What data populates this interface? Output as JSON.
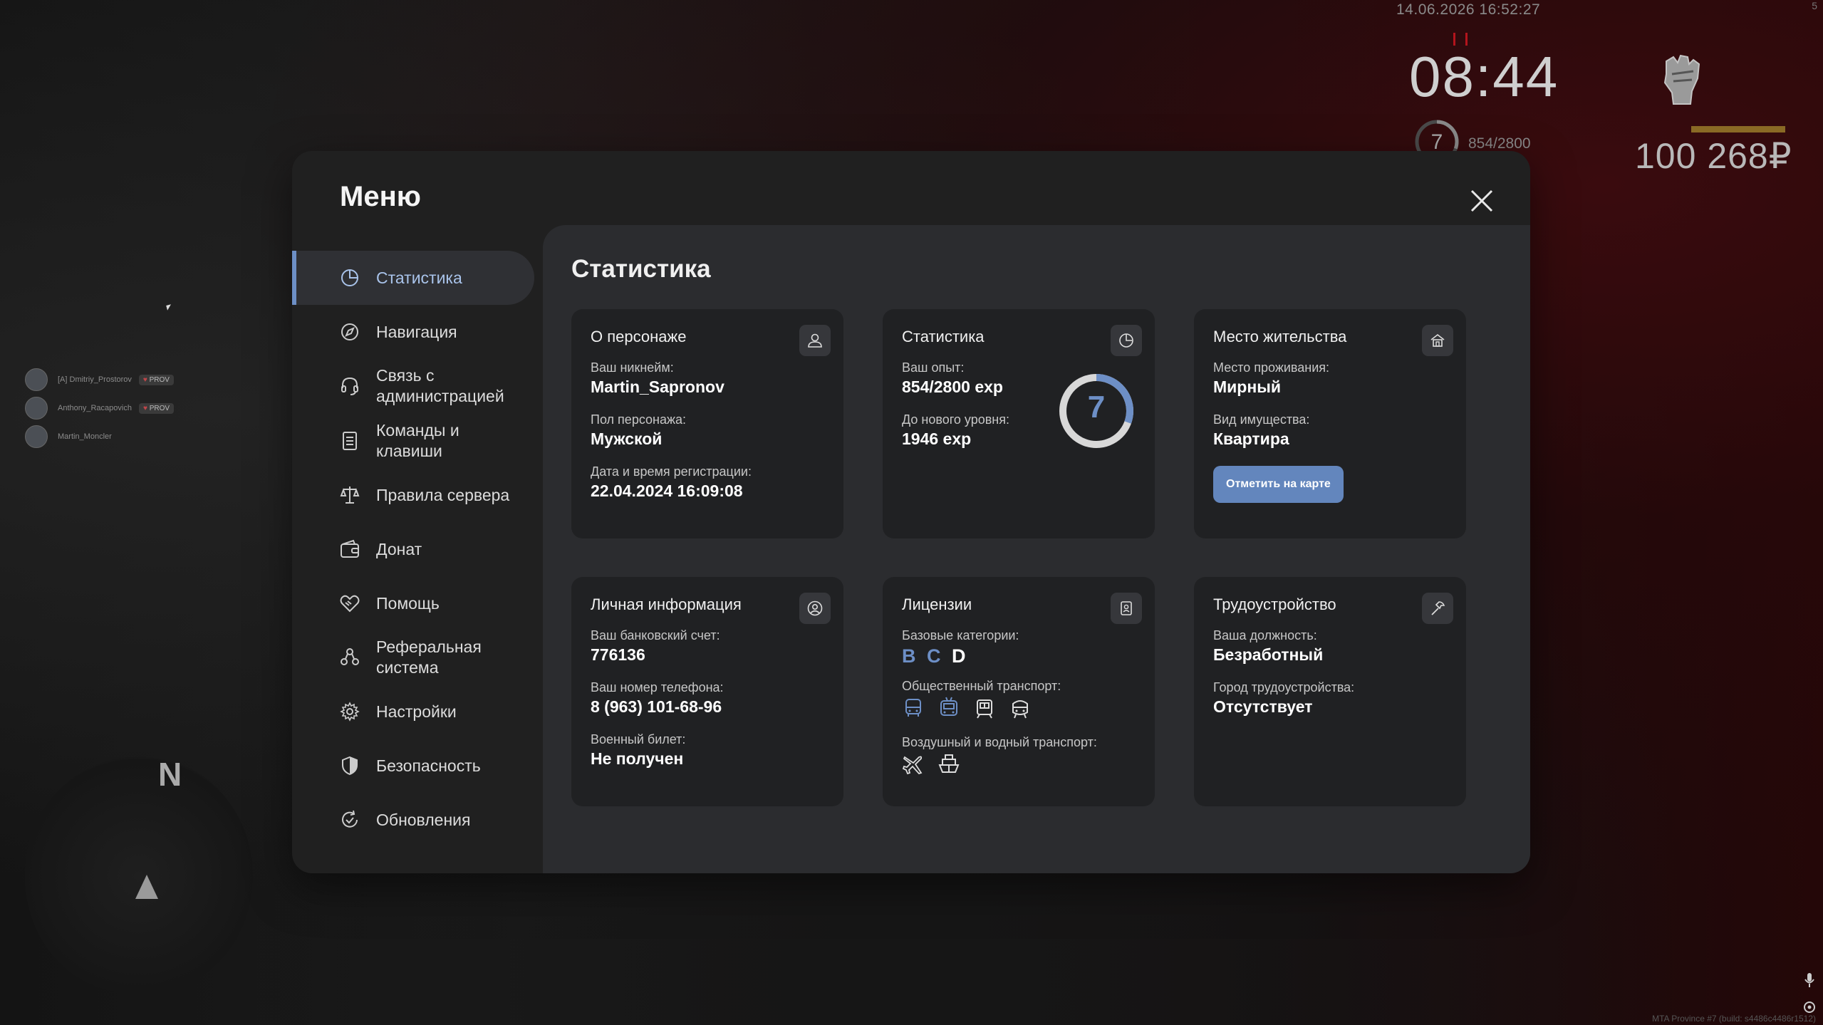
{
  "hud": {
    "datetime": "14.06.2026 16:52:27",
    "corner": "5",
    "clock": "08:44",
    "level": "7",
    "exp": "854/2800",
    "level_progress": 0.305,
    "money": "100 268₽",
    "build": "MTA Province #7 (build: s4486c4486r1512)"
  },
  "voice_chat": [
    {
      "name": "[A] Dmitriy_Prostorov",
      "badge": "PROV"
    },
    {
      "name": "Anthony_Racapovich",
      "badge": "PROV"
    },
    {
      "name": "Martin_Moncler",
      "badge": ""
    }
  ],
  "minimap": {
    "north": "N"
  },
  "menu": {
    "title": "Меню",
    "sidebar": [
      {
        "label": "Статистика",
        "icon": "pie-chart-icon",
        "active": true
      },
      {
        "label": "Навигация",
        "icon": "compass-icon"
      },
      {
        "label": "Связь с администрацией",
        "icon": "headset-icon"
      },
      {
        "label": "Команды и клавиши",
        "icon": "document-list-icon"
      },
      {
        "label": "Правила сервера",
        "icon": "scales-icon"
      },
      {
        "label": "Донат",
        "icon": "wallet-icon"
      },
      {
        "label": "Помощь",
        "icon": "handshake-heart-icon"
      },
      {
        "label": "Реферальная система",
        "icon": "referral-people-icon"
      },
      {
        "label": "Настройки",
        "icon": "gear-icon"
      },
      {
        "label": "Безопасность",
        "icon": "shield-icon"
      },
      {
        "label": "Обновления",
        "icon": "refresh-check-icon"
      }
    ]
  },
  "stats": {
    "title": "Статистика",
    "character": {
      "heading": "О персонаже",
      "nickname_label": "Ваш никнейм:",
      "nickname": "Martin_Sapronov",
      "gender_label": "Пол персонажа:",
      "gender": "Мужской",
      "reg_label": "Дата и время регистрации:",
      "reg": "22.04.2024 16:09:08"
    },
    "statistics": {
      "heading": "Статистика",
      "exp_label": "Ваш опыт:",
      "exp": "854/2800 exp",
      "next_label": "До нового уровня:",
      "next": "1946 exp",
      "level": "7",
      "progress": 0.305
    },
    "residence": {
      "heading": "Место жительства",
      "place_label": "Место проживания:",
      "place": "Мирный",
      "type_label": "Вид имущества:",
      "type": "Квартира",
      "button": "Отметить на карте"
    },
    "personal": {
      "heading": "Личная информация",
      "bank_label": "Ваш банковский счет:",
      "bank": "776136",
      "phone_label": "Ваш номер телефона:",
      "phone": "8 (963) 101-68-96",
      "military_label": "Военный билет:",
      "military": "Не получен"
    },
    "licenses": {
      "heading": "Лицензии",
      "base_label": "Базовые категории:",
      "cat1": "B",
      "cat2": "C",
      "cat3": "D",
      "public_label": "Общественный транспорт:",
      "public_icons": [
        "bus-icon",
        "trolleybus-icon",
        "tram-icon",
        "metro-icon"
      ],
      "air_label": "Воздушный и водный транспорт:",
      "air_icons": [
        "plane-icon",
        "ship-icon"
      ]
    },
    "employment": {
      "heading": "Трудоустройство",
      "position_label": "Ваша должность:",
      "position": "Безработный",
      "city_label": "Город трудоустройства:",
      "city": "Отсутствует"
    }
  },
  "colors": {
    "accent": "#6d8fc6",
    "button": "#6386bd",
    "modal": "#202020",
    "content": "#2b2c2f",
    "card": "#202123"
  }
}
